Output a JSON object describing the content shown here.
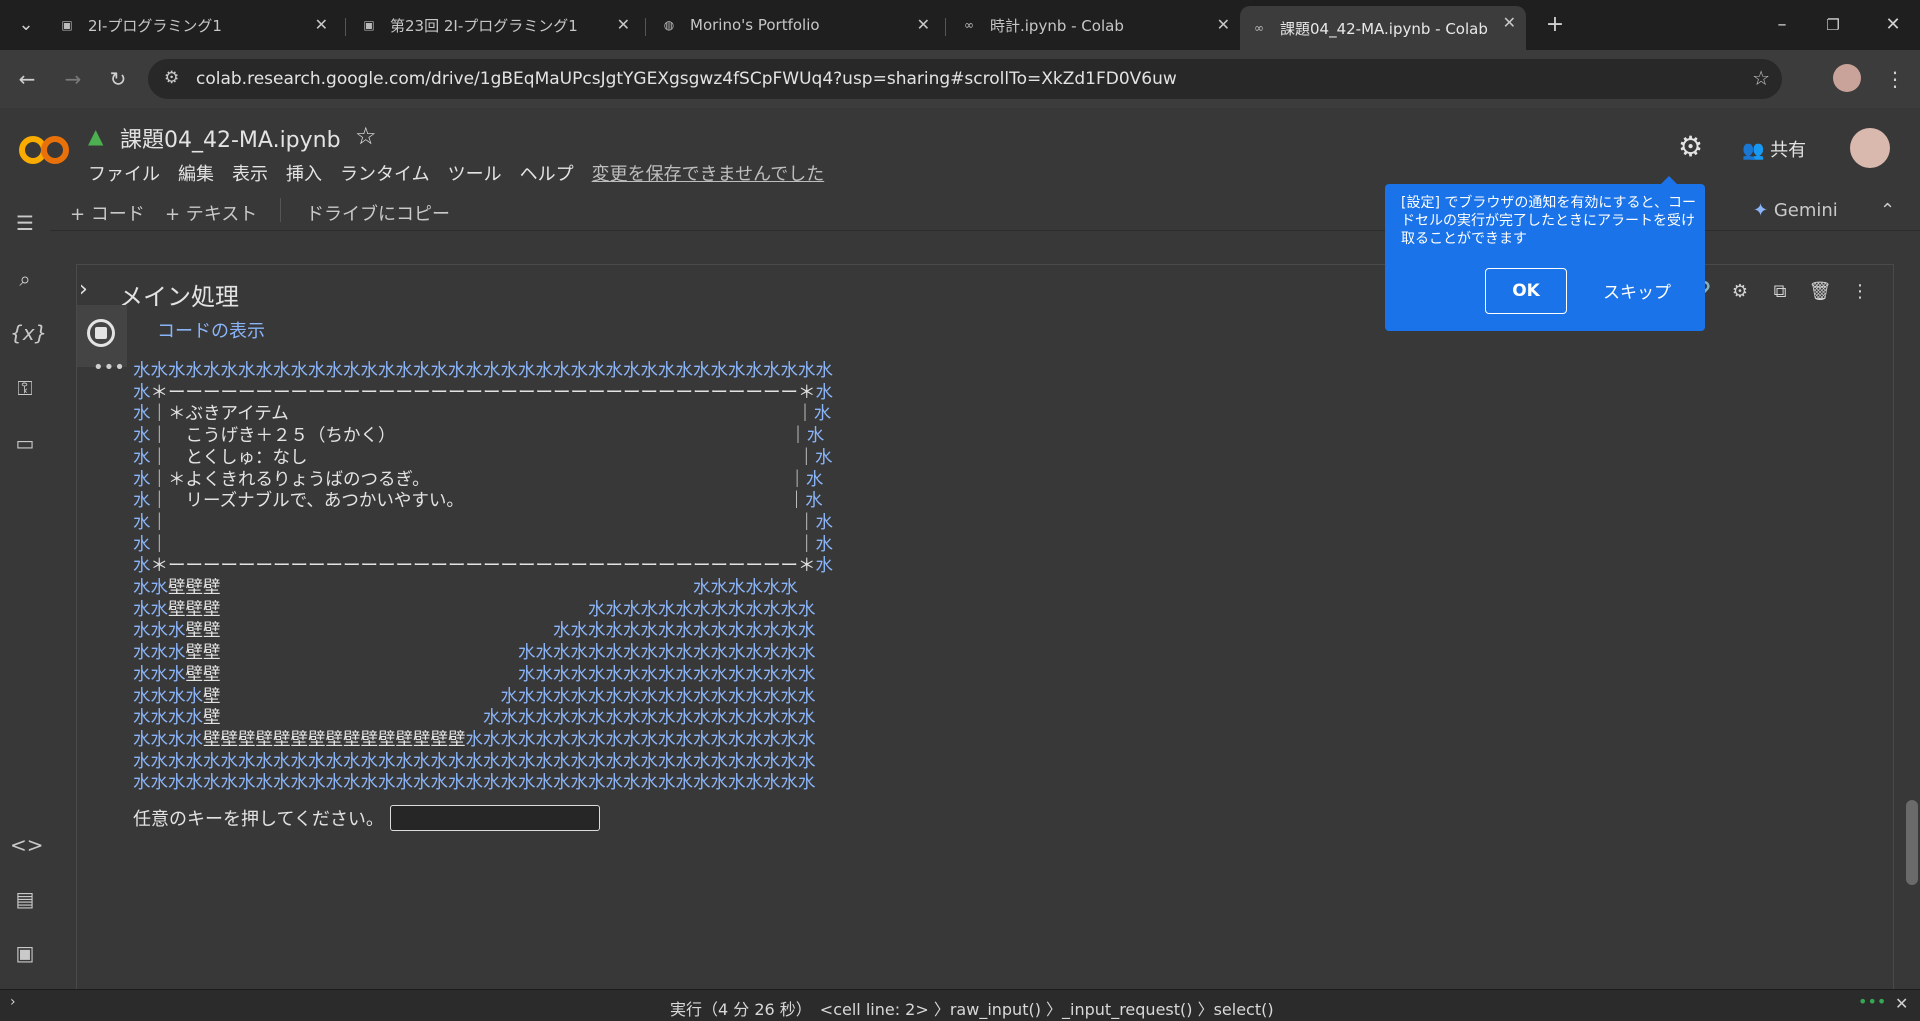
{
  "browser": {
    "tabs": [
      {
        "label": "2I-プログラミング1",
        "icon": "classroom-icon"
      },
      {
        "label": "第23回 2I-プログラミング1",
        "icon": "classroom-icon"
      },
      {
        "label": "Morino's Portfolio",
        "icon": "globe-icon"
      },
      {
        "label": "時計.ipynb - Colab",
        "icon": "colab-icon"
      },
      {
        "label": "課題04_42-MA.ipynb - Colab",
        "icon": "colab-icon",
        "active": true
      }
    ],
    "url": "colab.research.google.com/drive/1gBEqMaUPcsJgtYGEXgsgwz4fSCpFWUq4?usp=sharing#scrollTo=XkZd1FD0V6uw"
  },
  "colab": {
    "notebook_title": "課題04_42-MA.ipynb",
    "menu": [
      "ファイル",
      "編集",
      "表示",
      "挿入",
      "ランタイム",
      "ツール",
      "ヘルプ"
    ],
    "unsaved_notice": "変更を保存できませんでした",
    "share_label": "共有",
    "toolbar": {
      "add_code": "+ コード",
      "add_text": "+ テキスト",
      "copy_to_drive": "ドライブにコピー",
      "gemini": "Gemini"
    },
    "section_title": "メイン処理",
    "show_code": "コードの表示",
    "output_lines": [
      "水水水水水水水水水水水水水水水水水水水水水水水水水水水水水水水水水水水水水水水水",
      "水＊ーーーーーーーーーーーーーーーーーーーーーーーーーーーーーーーーーーーー＊水",
      "水｜＊ぶきアイテム　　　　　　　　　　　　　　　　　　　　　　　　　　　　　｜水",
      "水｜　こうげき＋２５（ちかく）　　　　　　　　　　　　　　　　　　　　　　　｜水",
      "水｜　とくしゅ：なし　　　　　　　　　　　　　　　　　　　　　　　　　　　　｜水",
      "水｜＊よくきれるりょうばのつるぎ。　　　　　　　　　　　　　　　　　　　　　｜水",
      "水｜　リーズナブルで、あつかいやすい。　　　　　　　　　　　　　　　　　　　｜水",
      "水｜　　　　　　　　　　　　　　　　　　　　　　　　　　　　　　　　　　　　｜水",
      "水｜　　　　　　　　　　　　　　　　　　　　　　　　　　　　　　　　　　　　｜水",
      "水＊ーーーーーーーーーーーーーーーーーーーーーーーーーーーーーーーーーーーー＊水",
      "水水壁壁壁　　　　　　　　　　　　　　　　　　　　　　　　　　　水水水水水水",
      "水水壁壁壁　　　　　　　　　　　　　　　　　　　　　水水水水水水水水水水水水水",
      "水水水壁壁　　　　　　　　　　　　　　　　　　　水水水水水水水水水水水水水水水",
      "水水水壁壁　　　　　　　　　　　　　　　　　水水水水水水水水水水水水水水水水水",
      "水水水壁壁　　　　　　　　　　　　　　　　　水水水水水水水水水水水水水水水水水",
      "水水水水壁　　　　　　　　　　　　　　　　水水水水水水水水水水水水水水水水水水",
      "水水水水壁　　　　　　　　　　　　　　　水水水水水水水水水水水水水水水水水水水",
      "水水水水壁壁壁壁壁壁壁壁壁壁壁壁壁壁壁水水水水水水水水水水水水水水水水水水水水",
      "水水水水水水水水水水水水水水水水水水水水水水水水水水水水水水水水水水水水水水水",
      "水水水水水水水水水水水水水水水水水水水水水水水水水水水水水水水水水水水水水水水"
    ],
    "input_prompt": "任意のキーを押してください。",
    "popup": {
      "text": "[設定] でブラウザの通知を有効にすると、コードセルの実行が完了したときにアラートを受け取ることができます",
      "ok": "OK",
      "skip": "スキップ"
    },
    "status": "実行（4 分 26 秒）　<cell line: 2> 〉raw_input() 〉_input_request() 〉select()"
  },
  "colors": {
    "accent": "#1a73e8",
    "water": "#8ab4f8",
    "bg": "#383838"
  }
}
